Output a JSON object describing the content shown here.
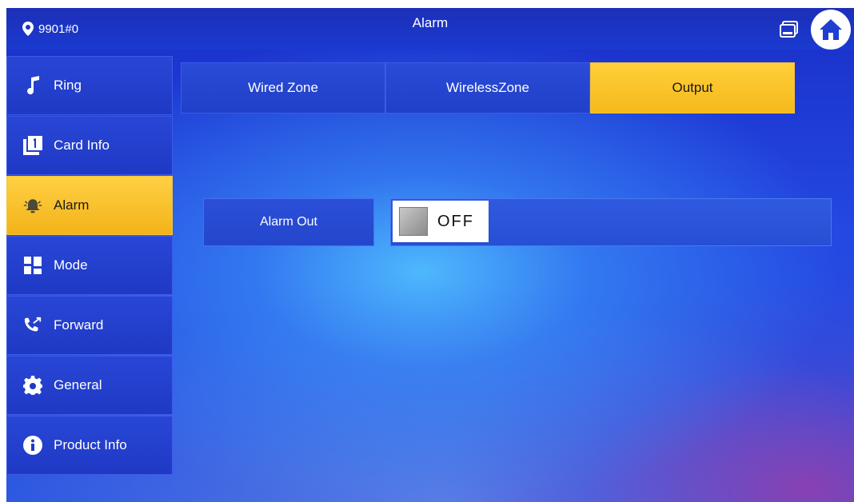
{
  "header": {
    "room_number": "9901#0",
    "title": "Alarm",
    "icons": [
      "location-pin-icon",
      "monitor-icon",
      "home-icon"
    ]
  },
  "sidebar": {
    "items": [
      {
        "label": "Ring",
        "icon": "music-note-icon"
      },
      {
        "label": "Card Info",
        "icon": "card-icon"
      },
      {
        "label": "Alarm",
        "icon": "alarm-bell-icon",
        "active": true
      },
      {
        "label": "Mode",
        "icon": "mode-grid-icon"
      },
      {
        "label": "Forward",
        "icon": "call-forward-icon"
      },
      {
        "label": "General",
        "icon": "gear-icon"
      },
      {
        "label": "Product Info",
        "icon": "info-icon"
      }
    ]
  },
  "tabs": [
    {
      "label": "Wired Zone"
    },
    {
      "label": "WirelessZone"
    },
    {
      "label": "Output",
      "active": true
    }
  ],
  "settings": {
    "alarm_out": {
      "label": "Alarm Out",
      "state": "OFF"
    }
  },
  "colors": {
    "active_accent": "#f6b91b",
    "panel_blue": "#2040c8",
    "background_blue": "#2448e2"
  }
}
